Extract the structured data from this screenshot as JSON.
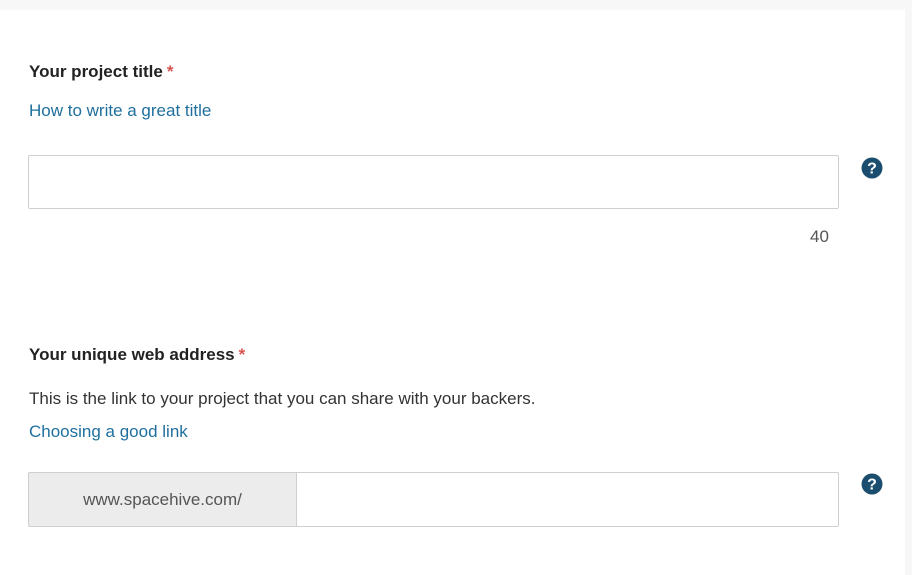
{
  "title_section": {
    "label": "Your project title",
    "required_mark": "*",
    "help_link": "How to write a great title",
    "input_value": "",
    "char_counter": "40"
  },
  "address_section": {
    "label": "Your unique web address",
    "required_mark": "*",
    "description": "This is the link to your project that you can share with your backers.",
    "help_link": "Choosing a good link",
    "url_prefix": "www.spacehive.com/",
    "input_value": ""
  },
  "icons": {
    "help": "question-circle-icon"
  },
  "colors": {
    "link": "#1f6f9e",
    "required": "#d9534f",
    "help_icon": "#1a4d6e"
  }
}
